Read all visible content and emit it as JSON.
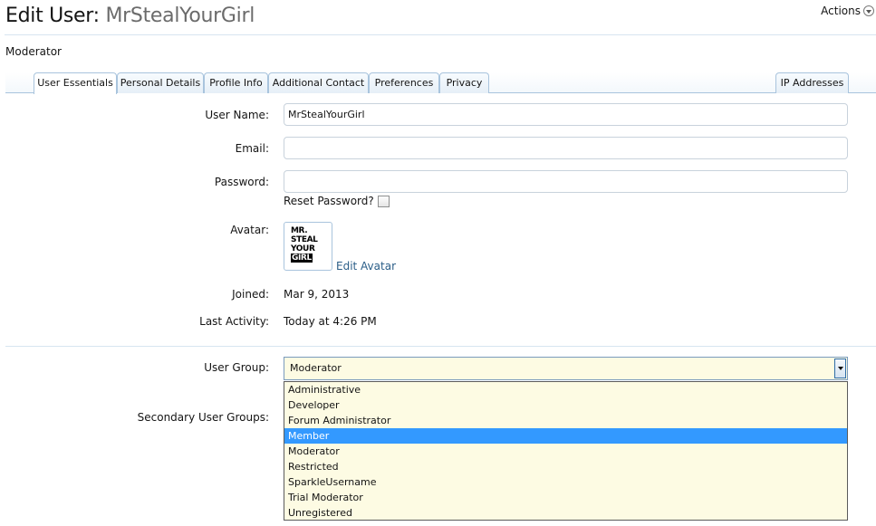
{
  "header": {
    "title_prefix": "Edit User:",
    "title_username": "MrStealYourGirl",
    "actions_label": "Actions",
    "subtitle": "Moderator"
  },
  "tabs": [
    {
      "label": "User Essentials",
      "active": true
    },
    {
      "label": "Personal Details",
      "active": false
    },
    {
      "label": "Profile Info",
      "active": false
    },
    {
      "label": "Additional Contact",
      "active": false
    },
    {
      "label": "Preferences",
      "active": false
    },
    {
      "label": "Privacy",
      "active": false
    },
    {
      "label": "IP Addresses",
      "active": false
    }
  ],
  "form": {
    "username_label": "User Name:",
    "username_value": "MrStealYourGirl",
    "email_label": "Email:",
    "email_value": "",
    "password_label": "Password:",
    "password_value": "",
    "reset_password_label": "Reset Password?",
    "avatar_label": "Avatar:",
    "avatar_text_line1": "MR.",
    "avatar_text_line2": "STEAL",
    "avatar_text_line3": "YOUR",
    "avatar_text_line4": "GIRL",
    "edit_avatar_label": "Edit Avatar",
    "joined_label": "Joined:",
    "joined_value": "Mar 9, 2013",
    "last_activity_label": "Last Activity:",
    "last_activity_value": "Today at 4:26 PM",
    "user_group_label": "User Group:",
    "user_group_value": "Moderator",
    "secondary_groups_label": "Secondary User Groups:"
  },
  "dropdown": {
    "options": [
      "Administrative",
      "Developer",
      "Forum Administrator",
      "Member",
      "Moderator",
      "Restricted",
      "SparkleUsername",
      "Trial Moderator",
      "Unregistered"
    ],
    "highlighted": "Member"
  },
  "colors": {
    "link": "#2b5e88",
    "tab_border": "#a9c4dd",
    "select_background": "#fdfbe3",
    "option_highlight": "#3399ff"
  },
  "icons": {
    "actions": "chevron-down-circle-icon",
    "select_arrow": "chevron-down-icon"
  }
}
